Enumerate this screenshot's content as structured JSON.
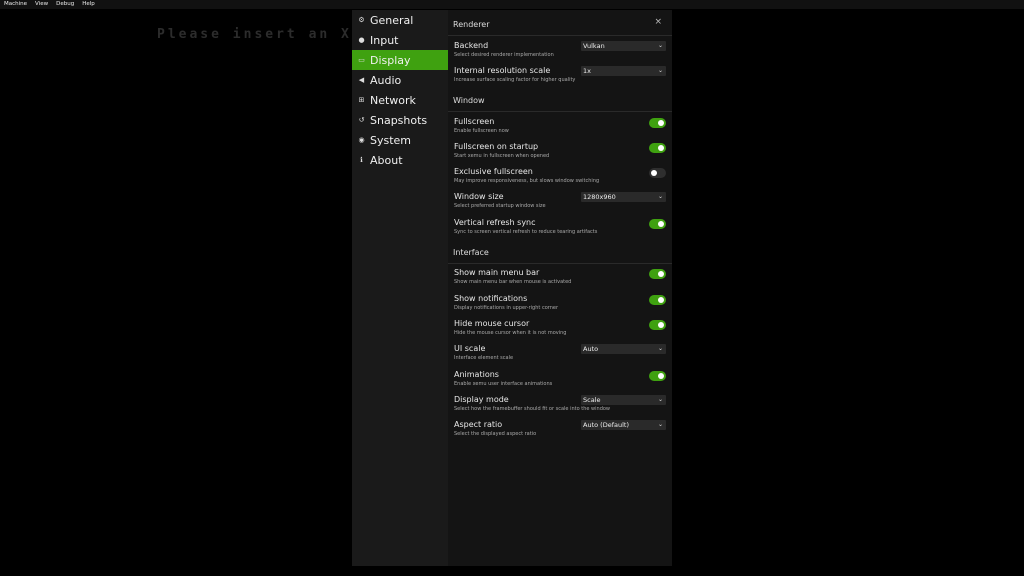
{
  "menubar": [
    "Machine",
    "View",
    "Debug",
    "Help"
  ],
  "background_text": "Please insert an X",
  "sidebar": {
    "items": [
      {
        "label": "General",
        "icon": "gears-icon",
        "active": false
      },
      {
        "label": "Input",
        "icon": "gamepad-icon",
        "active": false
      },
      {
        "label": "Display",
        "icon": "monitor-icon",
        "active": true
      },
      {
        "label": "Audio",
        "icon": "speaker-icon",
        "active": false
      },
      {
        "label": "Network",
        "icon": "network-icon",
        "active": false
      },
      {
        "label": "Snapshots",
        "icon": "history-icon",
        "active": false
      },
      {
        "label": "System",
        "icon": "chip-icon",
        "active": false
      },
      {
        "label": "About",
        "icon": "info-icon",
        "active": false
      }
    ]
  },
  "panel": {
    "close_label": "×",
    "sections": [
      {
        "title": "Renderer"
      },
      {
        "title": "Window"
      },
      {
        "title": "Interface"
      }
    ],
    "settings": [
      {
        "label": "Backend",
        "desc": "Select desired renderer implementation",
        "type": "select",
        "value": "Vulkan"
      },
      {
        "label": "Internal resolution scale",
        "desc": "Increase surface scaling factor for higher quality",
        "type": "select",
        "value": "1x"
      },
      {
        "label": "Fullscreen",
        "desc": "Enable fullscreen now",
        "type": "toggle",
        "on": true
      },
      {
        "label": "Fullscreen on startup",
        "desc": "Start xemu in fullscreen when opened",
        "type": "toggle",
        "on": true
      },
      {
        "label": "Exclusive fullscreen",
        "desc": "May improve responsiveness, but slows window switching",
        "type": "toggle",
        "on": false
      },
      {
        "label": "Window size",
        "desc": "Select preferred startup window size",
        "type": "select",
        "value": "1280x960"
      },
      {
        "label": "Vertical refresh sync",
        "desc": "Sync to screen vertical refresh to reduce tearing artifacts",
        "type": "toggle",
        "on": true
      },
      {
        "label": "Show main menu bar",
        "desc": "Show main menu bar when mouse is activated",
        "type": "toggle",
        "on": true
      },
      {
        "label": "Show notifications",
        "desc": "Display notifications in upper-right corner",
        "type": "toggle",
        "on": true
      },
      {
        "label": "Hide mouse cursor",
        "desc": "Hide the mouse cursor when it is not moving",
        "type": "toggle",
        "on": true
      },
      {
        "label": "UI scale",
        "desc": "Interface element scale",
        "type": "select",
        "value": "Auto"
      },
      {
        "label": "Animations",
        "desc": "Enable xemu user interface animations",
        "type": "toggle",
        "on": true
      },
      {
        "label": "Display mode",
        "desc": "Select how the framebuffer should fit or scale into the window",
        "type": "select",
        "value": "Scale"
      },
      {
        "label": "Aspect ratio",
        "desc": "Select the displayed aspect ratio",
        "type": "select",
        "value": "Auto (Default)"
      }
    ]
  },
  "colors": {
    "accent": "#3fa110",
    "panel": "#141414",
    "sidebar": "#1a1a1a"
  }
}
